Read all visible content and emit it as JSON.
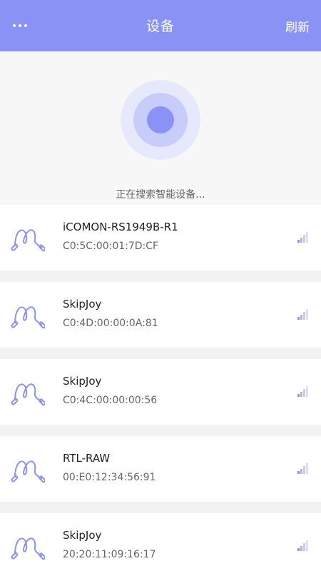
{
  "header": {
    "title": "设备",
    "refresh_label": "刷新"
  },
  "scan": {
    "status_text": "正在搜索智能设备..."
  },
  "devices": [
    {
      "name": "iCOMON-RS1949B-R1",
      "mac": "C0:5C:00:01:7D:CF"
    },
    {
      "name": "SkipJoy",
      "mac": "C0:4D:00:00:0A:81"
    },
    {
      "name": "SkipJoy",
      "mac": "C0:4C:00:00:00:56"
    },
    {
      "name": "RTL-RAW",
      "mac": "00:E0:12:34:56:91"
    },
    {
      "name": "SkipJoy",
      "mac": "20:20:11:09:16:17"
    }
  ],
  "colors": {
    "accent": "#8a93f5",
    "ring_outer": "#e6e8fc",
    "ring_middle": "#c7ccfa"
  },
  "icons": {
    "more": "more-dots-icon",
    "device": "jump-rope-icon",
    "signal": "signal-strength-icon"
  }
}
